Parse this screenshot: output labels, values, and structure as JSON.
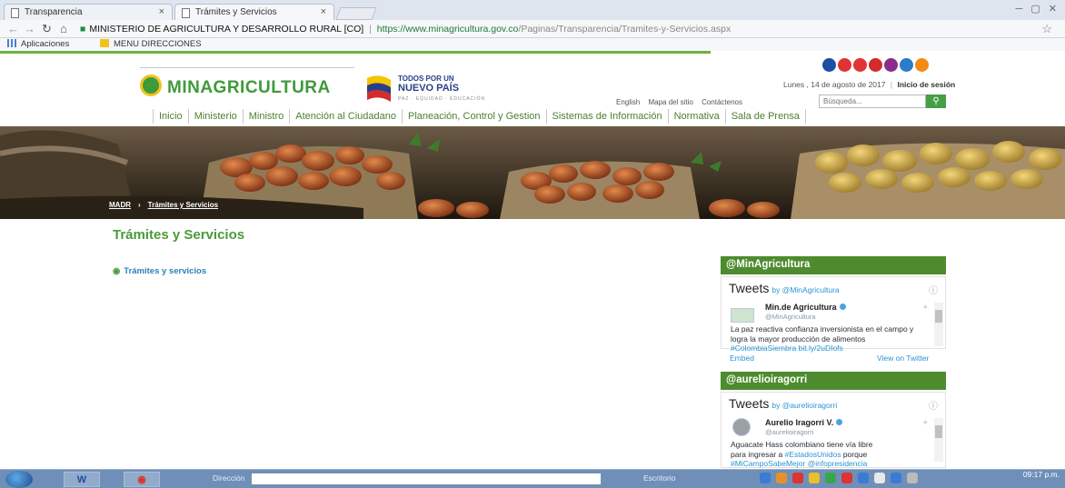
{
  "browser": {
    "tabs": [
      {
        "title": "Transparencia",
        "close": "×"
      },
      {
        "title": "Trámites y Servicios",
        "close": "×"
      }
    ],
    "url": {
      "host": "MINISTERIO DE AGRICULTURA Y DESARROLLO RURAL [CO]",
      "separator": "|",
      "scheme_domain": "https://www.minagricultura.gov.co",
      "path": "/Paginas/Transparencia/Tramites-y-Servicios.aspx"
    },
    "bookmarks": [
      "Aplicaciones",
      "MENU DIRECCIONES"
    ]
  },
  "header": {
    "logo_text": "MINAGRICULTURA",
    "slogan_line1": "TODOS POR UN",
    "slogan_line2": "NUEVO PAÍS",
    "slogan_line3": "PAZ · EQUIDAD · EDUCACIÓN",
    "date_text": "Lunes , 14 de agosto de 2017",
    "login_link": "Inicio de sesión",
    "utility_links": [
      "English",
      "Mapa del sitio",
      "Contáctenos"
    ],
    "search_placeholder": "Búsqueda...",
    "social_colors": [
      "#1d4ea3",
      "#e03434",
      "#e03434",
      "#d42a2a",
      "#8b2d8b",
      "#2b7cc9",
      "#f28a16"
    ]
  },
  "nav": {
    "items": [
      "Inicio",
      "Ministerio",
      "Ministro",
      "Atención al Ciudadano",
      "Planeación, Control y Gestion",
      "Sistemas de Información",
      "Normativa",
      "Sala de Prensa"
    ]
  },
  "breadcrumb": {
    "home": "MADR",
    "current": "Trámites y Servicios"
  },
  "content": {
    "title": "Trámites y Servicios",
    "link": "Trámites y servicios"
  },
  "sidebar": {
    "widgets": [
      {
        "heading": "@MinAgricultura",
        "tweets_label": "Tweets",
        "by": "by @MinAgricultura",
        "author": "Min.de Agricultura",
        "handle": "@MinAgricultura",
        "text_plain": "La paz reactiva confianza inversionista en el campo y logra la mayor producción de alimentos ",
        "text_link": "#ColombiaSiembra bit.ly/2uDIofs",
        "embed": "Embed",
        "view_on": "View on Twitter"
      },
      {
        "heading": "@aurelioiragorri",
        "tweets_label": "Tweets",
        "by": "by @aurelioiragorri",
        "author": "Aurelio Iragorri V.",
        "handle": "@aurelioiragorri",
        "text_line1": "Aguacate Hass colombiano tiene vía libre",
        "text_line2a": "para ingresar a ",
        "text_line2b": "#EstadosUnidos",
        "text_line2c": " porque",
        "text_line3": "#MiCampoSabeMejor @infopresidencia"
      }
    ]
  },
  "taskbar": {
    "address_label": "Dirección",
    "desktop_label": "Escritorio",
    "time": "09:17 p.m."
  }
}
